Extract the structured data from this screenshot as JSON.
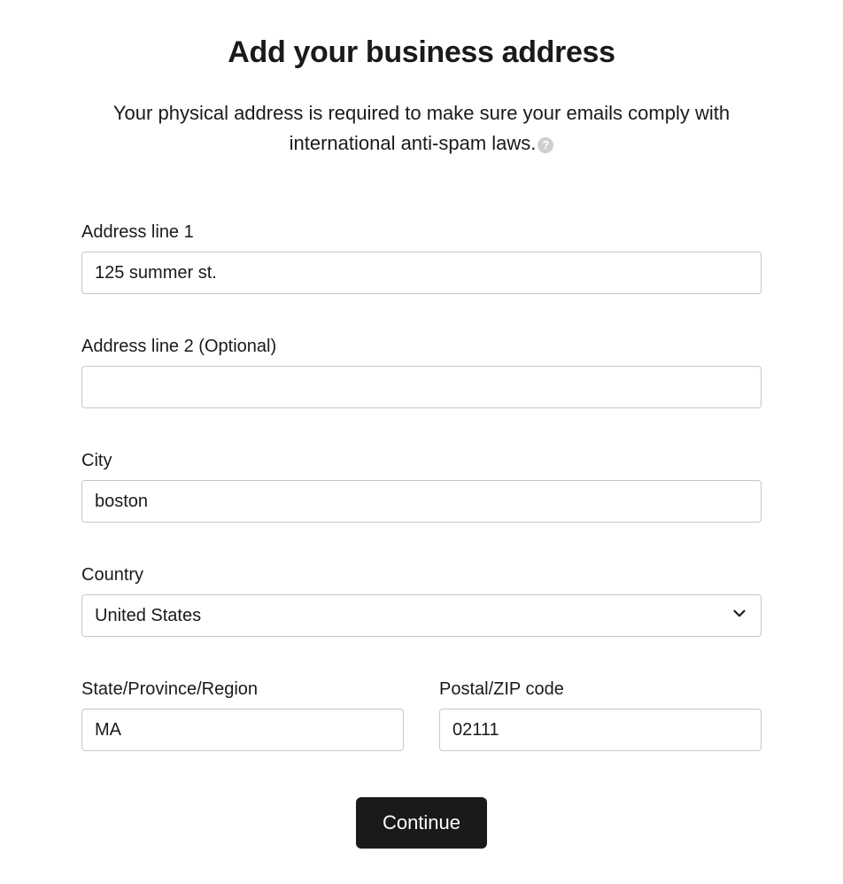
{
  "header": {
    "title": "Add your business address",
    "subtitle_part1": "Your physical address is required to make sure your emails comply with international anti-spam laws.",
    "help_glyph": "?"
  },
  "fields": {
    "address1": {
      "label": "Address line 1",
      "value": "125 summer st."
    },
    "address2": {
      "label": "Address line 2 (Optional)",
      "value": ""
    },
    "city": {
      "label": "City",
      "value": "boston"
    },
    "country": {
      "label": "Country",
      "value": "United States"
    },
    "state": {
      "label": "State/Province/Region",
      "value": "MA"
    },
    "postal": {
      "label": "Postal/ZIP code",
      "value": "02111"
    }
  },
  "actions": {
    "continue_label": "Continue"
  }
}
